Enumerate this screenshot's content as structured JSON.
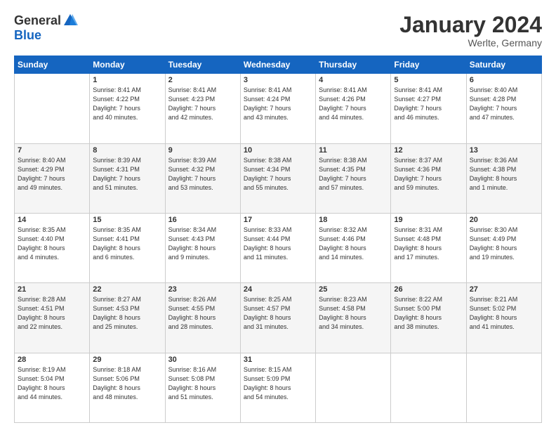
{
  "logo": {
    "general": "General",
    "blue": "Blue"
  },
  "title": "January 2024",
  "location": "Werlte, Germany",
  "headers": [
    "Sunday",
    "Monday",
    "Tuesday",
    "Wednesday",
    "Thursday",
    "Friday",
    "Saturday"
  ],
  "weeks": [
    [
      {
        "day": "",
        "info": ""
      },
      {
        "day": "1",
        "info": "Sunrise: 8:41 AM\nSunset: 4:22 PM\nDaylight: 7 hours\nand 40 minutes."
      },
      {
        "day": "2",
        "info": "Sunrise: 8:41 AM\nSunset: 4:23 PM\nDaylight: 7 hours\nand 42 minutes."
      },
      {
        "day": "3",
        "info": "Sunrise: 8:41 AM\nSunset: 4:24 PM\nDaylight: 7 hours\nand 43 minutes."
      },
      {
        "day": "4",
        "info": "Sunrise: 8:41 AM\nSunset: 4:26 PM\nDaylight: 7 hours\nand 44 minutes."
      },
      {
        "day": "5",
        "info": "Sunrise: 8:41 AM\nSunset: 4:27 PM\nDaylight: 7 hours\nand 46 minutes."
      },
      {
        "day": "6",
        "info": "Sunrise: 8:40 AM\nSunset: 4:28 PM\nDaylight: 7 hours\nand 47 minutes."
      }
    ],
    [
      {
        "day": "7",
        "info": "Sunrise: 8:40 AM\nSunset: 4:29 PM\nDaylight: 7 hours\nand 49 minutes."
      },
      {
        "day": "8",
        "info": "Sunrise: 8:39 AM\nSunset: 4:31 PM\nDaylight: 7 hours\nand 51 minutes."
      },
      {
        "day": "9",
        "info": "Sunrise: 8:39 AM\nSunset: 4:32 PM\nDaylight: 7 hours\nand 53 minutes."
      },
      {
        "day": "10",
        "info": "Sunrise: 8:38 AM\nSunset: 4:34 PM\nDaylight: 7 hours\nand 55 minutes."
      },
      {
        "day": "11",
        "info": "Sunrise: 8:38 AM\nSunset: 4:35 PM\nDaylight: 7 hours\nand 57 minutes."
      },
      {
        "day": "12",
        "info": "Sunrise: 8:37 AM\nSunset: 4:36 PM\nDaylight: 7 hours\nand 59 minutes."
      },
      {
        "day": "13",
        "info": "Sunrise: 8:36 AM\nSunset: 4:38 PM\nDaylight: 8 hours\nand 1 minute."
      }
    ],
    [
      {
        "day": "14",
        "info": "Sunrise: 8:35 AM\nSunset: 4:40 PM\nDaylight: 8 hours\nand 4 minutes."
      },
      {
        "day": "15",
        "info": "Sunrise: 8:35 AM\nSunset: 4:41 PM\nDaylight: 8 hours\nand 6 minutes."
      },
      {
        "day": "16",
        "info": "Sunrise: 8:34 AM\nSunset: 4:43 PM\nDaylight: 8 hours\nand 9 minutes."
      },
      {
        "day": "17",
        "info": "Sunrise: 8:33 AM\nSunset: 4:44 PM\nDaylight: 8 hours\nand 11 minutes."
      },
      {
        "day": "18",
        "info": "Sunrise: 8:32 AM\nSunset: 4:46 PM\nDaylight: 8 hours\nand 14 minutes."
      },
      {
        "day": "19",
        "info": "Sunrise: 8:31 AM\nSunset: 4:48 PM\nDaylight: 8 hours\nand 17 minutes."
      },
      {
        "day": "20",
        "info": "Sunrise: 8:30 AM\nSunset: 4:49 PM\nDaylight: 8 hours\nand 19 minutes."
      }
    ],
    [
      {
        "day": "21",
        "info": "Sunrise: 8:28 AM\nSunset: 4:51 PM\nDaylight: 8 hours\nand 22 minutes."
      },
      {
        "day": "22",
        "info": "Sunrise: 8:27 AM\nSunset: 4:53 PM\nDaylight: 8 hours\nand 25 minutes."
      },
      {
        "day": "23",
        "info": "Sunrise: 8:26 AM\nSunset: 4:55 PM\nDaylight: 8 hours\nand 28 minutes."
      },
      {
        "day": "24",
        "info": "Sunrise: 8:25 AM\nSunset: 4:57 PM\nDaylight: 8 hours\nand 31 minutes."
      },
      {
        "day": "25",
        "info": "Sunrise: 8:23 AM\nSunset: 4:58 PM\nDaylight: 8 hours\nand 34 minutes."
      },
      {
        "day": "26",
        "info": "Sunrise: 8:22 AM\nSunset: 5:00 PM\nDaylight: 8 hours\nand 38 minutes."
      },
      {
        "day": "27",
        "info": "Sunrise: 8:21 AM\nSunset: 5:02 PM\nDaylight: 8 hours\nand 41 minutes."
      }
    ],
    [
      {
        "day": "28",
        "info": "Sunrise: 8:19 AM\nSunset: 5:04 PM\nDaylight: 8 hours\nand 44 minutes."
      },
      {
        "day": "29",
        "info": "Sunrise: 8:18 AM\nSunset: 5:06 PM\nDaylight: 8 hours\nand 48 minutes."
      },
      {
        "day": "30",
        "info": "Sunrise: 8:16 AM\nSunset: 5:08 PM\nDaylight: 8 hours\nand 51 minutes."
      },
      {
        "day": "31",
        "info": "Sunrise: 8:15 AM\nSunset: 5:09 PM\nDaylight: 8 hours\nand 54 minutes."
      },
      {
        "day": "",
        "info": ""
      },
      {
        "day": "",
        "info": ""
      },
      {
        "day": "",
        "info": ""
      }
    ]
  ]
}
